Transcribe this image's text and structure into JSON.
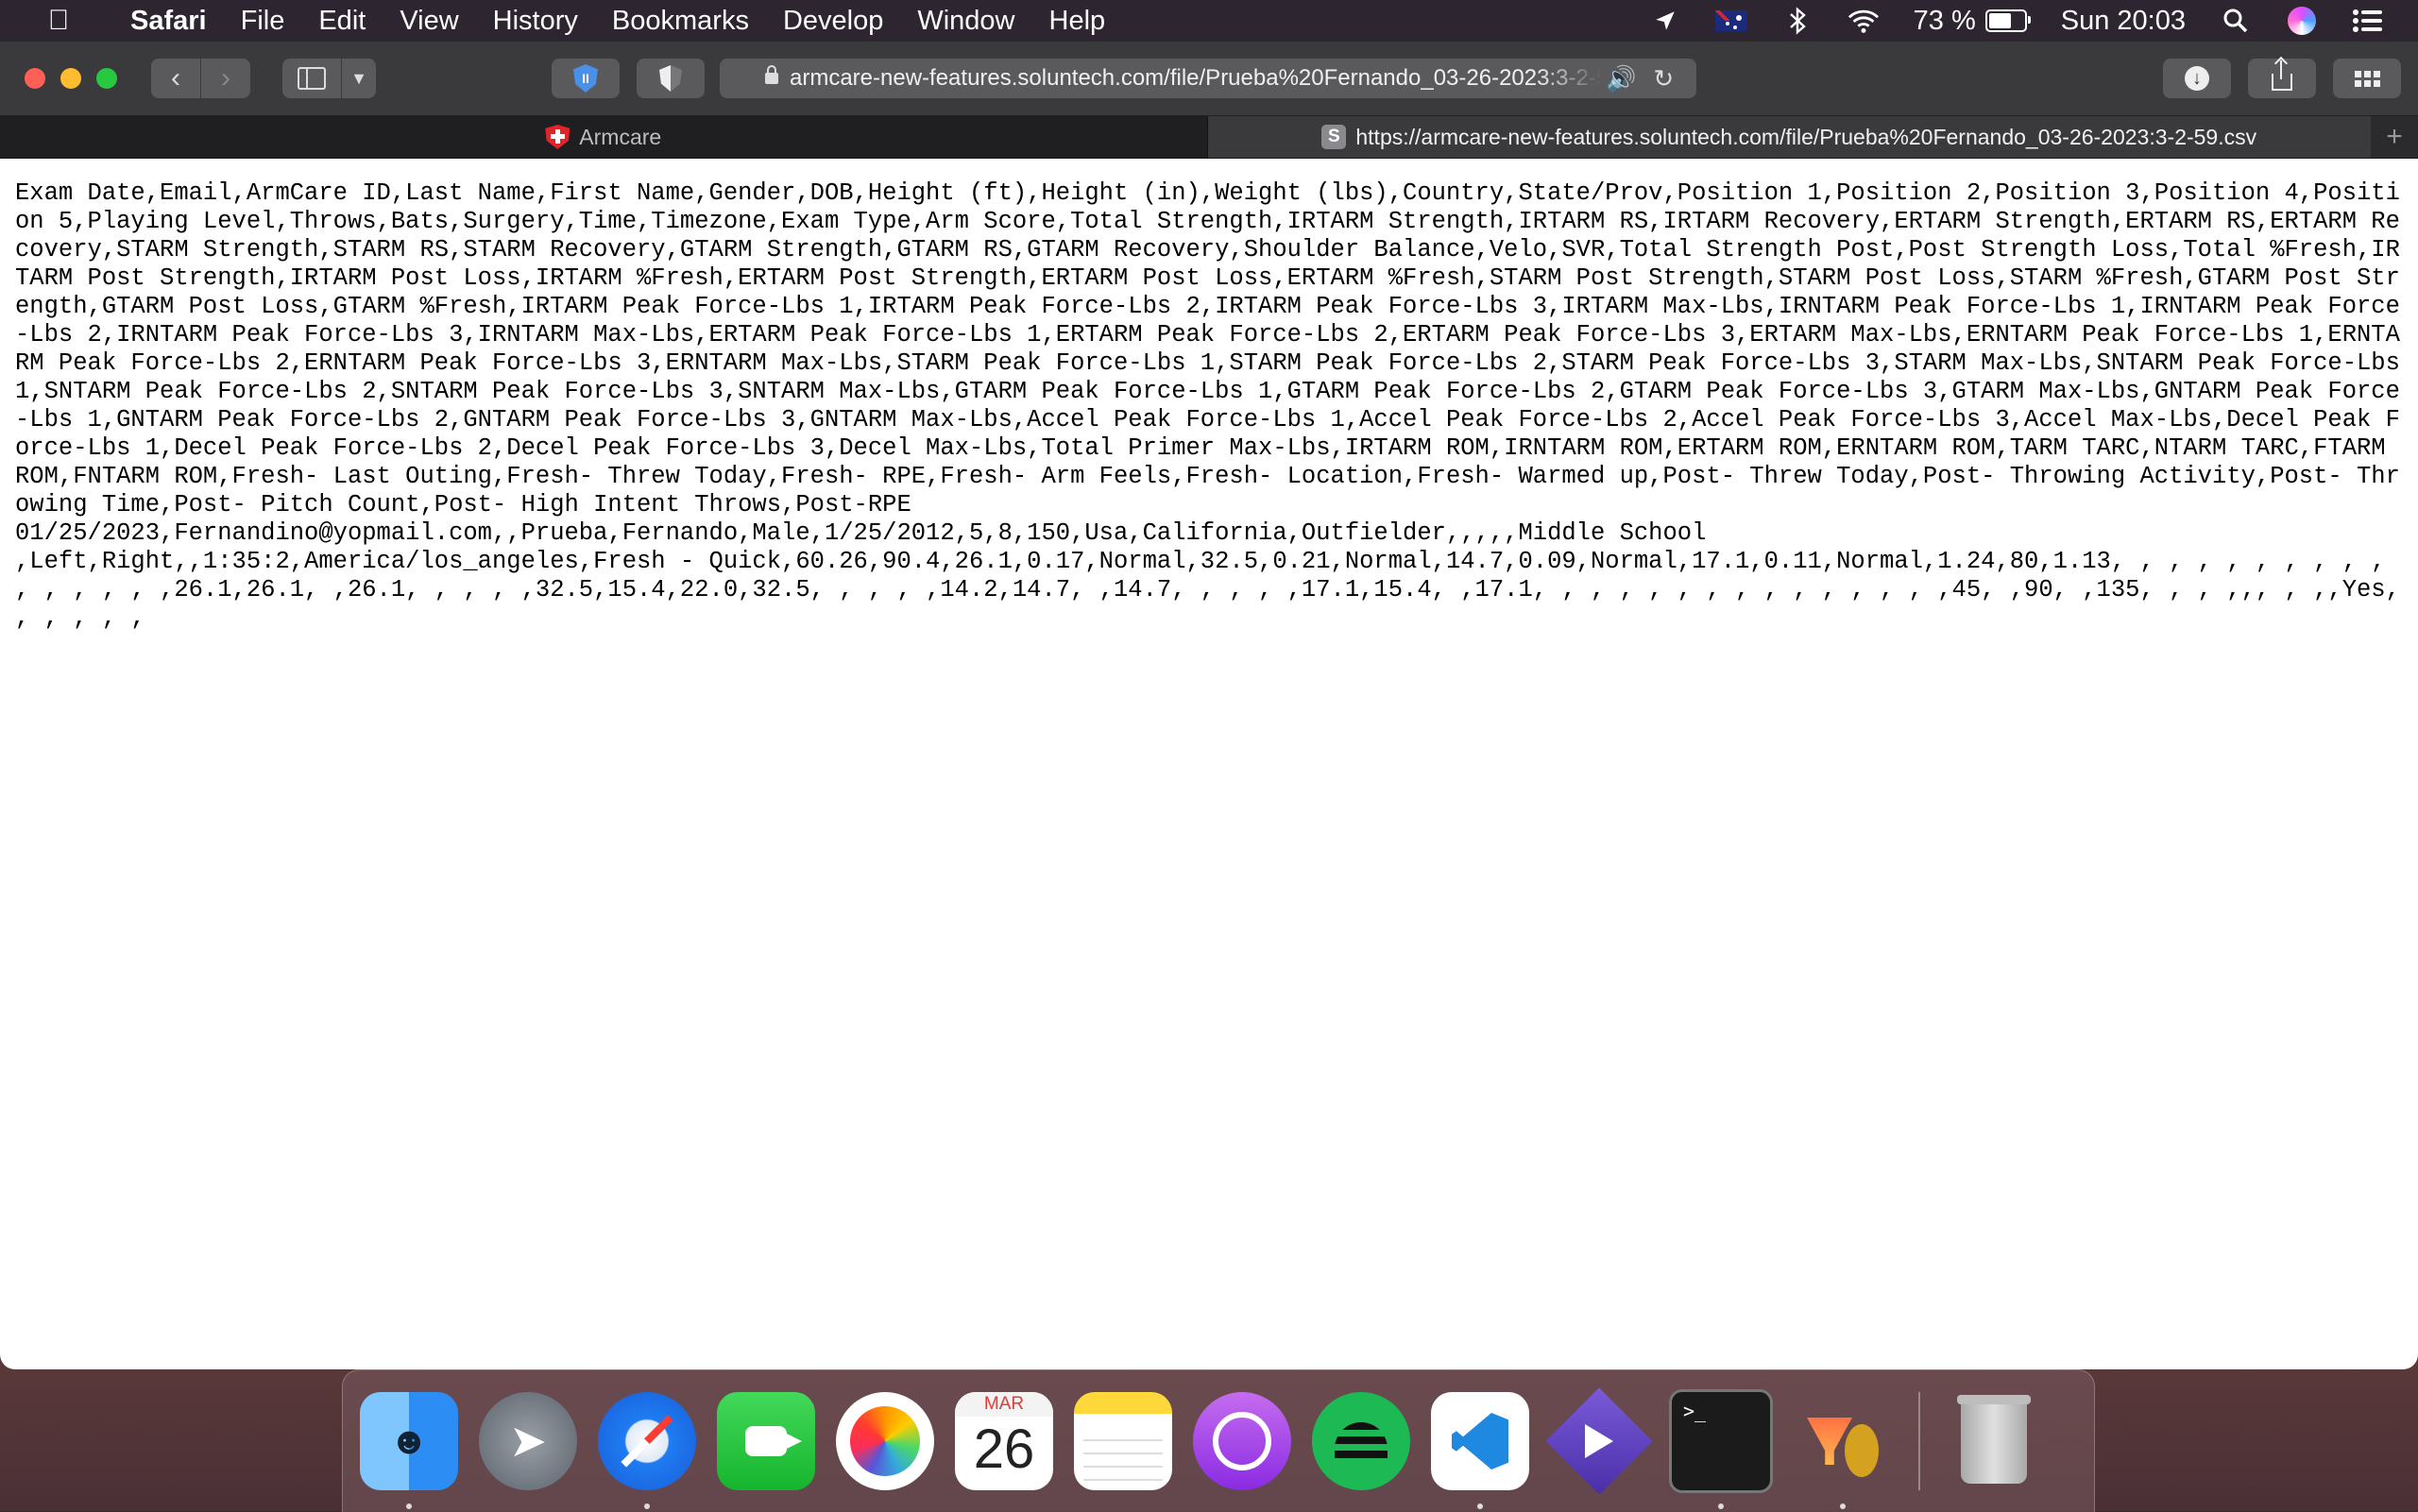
{
  "menubar": {
    "app_name": "Safari",
    "menus": [
      "File",
      "Edit",
      "View",
      "History",
      "Bookmarks",
      "Develop",
      "Window",
      "Help"
    ],
    "battery_percent_label": "73 %",
    "battery_level": 0.73,
    "clock": "Sun 20:03",
    "icons": [
      "location-arrow-icon",
      "flag-australia-icon",
      "bluetooth-icon",
      "wifi-icon",
      "battery-icon",
      "spotlight-icon",
      "siri-icon",
      "control-center-icon"
    ]
  },
  "toolbar": {
    "url": "armcare-new-features.soluntech.com/file/Prueba%20Fernando_03-26-2023:3-2-59.csv",
    "audio_playing": true
  },
  "tabs": [
    {
      "label": "Armcare",
      "favicon": "armcare-red-shield",
      "active": false
    },
    {
      "label": "https://armcare-new-features.soluntech.com/file/Prueba%20Fernando_03-26-2023:3-2-59.csv",
      "favicon": "S",
      "active": true
    }
  ],
  "page": {
    "csv_text": "Exam Date,Email,ArmCare ID,Last Name,First Name,Gender,DOB,Height (ft),Height (in),Weight (lbs),Country,State/Prov,Position 1,Position 2,Position 3,Position 4,Position 5,Playing Level,Throws,Bats,Surgery,Time,Timezone,Exam Type,Arm Score,Total Strength,IRTARM Strength,IRTARM RS,IRTARM Recovery,ERTARM Strength,ERTARM RS,ERTARM Recovery,STARM Strength,STARM RS,STARM Recovery,GTARM Strength,GTARM RS,GTARM Recovery,Shoulder Balance,Velo,SVR,Total Strength Post,Post Strength Loss,Total %Fresh,IRTARM Post Strength,IRTARM Post Loss,IRTARM %Fresh,ERTARM Post Strength,ERTARM Post Loss,ERTARM %Fresh,STARM Post Strength,STARM Post Loss,STARM %Fresh,GTARM Post Strength,GTARM Post Loss,GTARM %Fresh,IRTARM Peak Force-Lbs 1,IRTARM Peak Force-Lbs 2,IRTARM Peak Force-Lbs 3,IRTARM Max-Lbs,IRNTARM Peak Force-Lbs 1,IRNTARM Peak Force-Lbs 2,IRNTARM Peak Force-Lbs 3,IRNTARM Max-Lbs,ERTARM Peak Force-Lbs 1,ERTARM Peak Force-Lbs 2,ERTARM Peak Force-Lbs 3,ERTARM Max-Lbs,ERNTARM Peak Force-Lbs 1,ERNTARM Peak Force-Lbs 2,ERNTARM Peak Force-Lbs 3,ERNTARM Max-Lbs,STARM Peak Force-Lbs 1,STARM Peak Force-Lbs 2,STARM Peak Force-Lbs 3,STARM Max-Lbs,SNTARM Peak Force-Lbs 1,SNTARM Peak Force-Lbs 2,SNTARM Peak Force-Lbs 3,SNTARM Max-Lbs,GTARM Peak Force-Lbs 1,GTARM Peak Force-Lbs 2,GTARM Peak Force-Lbs 3,GTARM Max-Lbs,GNTARM Peak Force-Lbs 1,GNTARM Peak Force-Lbs 2,GNTARM Peak Force-Lbs 3,GNTARM Max-Lbs,Accel Peak Force-Lbs 1,Accel Peak Force-Lbs 2,Accel Peak Force-Lbs 3,Accel Max-Lbs,Decel Peak Force-Lbs 1,Decel Peak Force-Lbs 2,Decel Peak Force-Lbs 3,Decel Max-Lbs,Total Primer Max-Lbs,IRTARM ROM,IRNTARM ROM,ERTARM ROM,ERNTARM ROM,TARM TARC,NTARM TARC,FTARM ROM,FNTARM ROM,Fresh- Last Outing,Fresh- Threw Today,Fresh- RPE,Fresh- Arm Feels,Fresh- Location,Fresh- Warmed up,Post- Threw Today,Post- Throwing Activity,Post- Throwing Time,Post- Pitch Count,Post- High Intent Throws,Post-RPE\n01/25/2023,Fernandino@yopmail.com,,Prueba,Fernando,Male,1/25/2012,5,8,150,Usa,California,Outfielder,,,,,Middle School\n,Left,Right,,1:35:2,America/los_angeles,Fresh - Quick,60.26,90.4,26.1,0.17,Normal,32.5,0.21,Normal,14.7,0.09,Normal,17.1,0.11,Normal,1.24,80,1.13, , , , , , , , , , , , , , , ,26.1,26.1, ,26.1, , , , ,32.5,15.4,22.0,32.5, , , , ,14.2,14.7, ,14.7, , , , ,17.1,15.4, ,17.1, , , , , , , , , , , , , , ,45, ,90, ,135, , , ,,, , ,,Yes, , , , , ,"
  },
  "dock": {
    "calendar_month": "MAR",
    "calendar_day": "26",
    "terminal_prompt": ">_",
    "apps": [
      "Finder",
      "Launchpad",
      "Safari",
      "FaceTime",
      "Photos",
      "Calendar",
      "Notes",
      "Podcasts",
      "Spotify",
      "Visual Studio Code",
      "Infuse",
      "Terminal",
      "HandBrake",
      "Trash"
    ]
  }
}
